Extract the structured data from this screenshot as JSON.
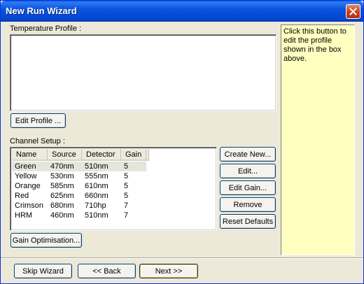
{
  "window": {
    "title": "New Run Wizard"
  },
  "temperature_profile": {
    "label": "Temperature Profile :",
    "edit_button": "Edit Profile ..."
  },
  "help": {
    "text": "Click this button to edit the profile shown in the box above."
  },
  "channel_setup": {
    "label": "Channel Setup :",
    "columns": [
      "Name",
      "Source",
      "Detector",
      "Gain"
    ],
    "rows": [
      [
        "Green",
        "470nm",
        "510nm",
        "5"
      ],
      [
        "Yellow",
        "530nm",
        "555nm",
        "5"
      ],
      [
        "Orange",
        "585nm",
        "610nm",
        "5"
      ],
      [
        "Red",
        "625nm",
        "660nm",
        "5"
      ],
      [
        "Crimson",
        "680nm",
        "710hp",
        "7"
      ],
      [
        "HRM",
        "460nm",
        "510nm",
        "7"
      ]
    ],
    "selected_row": 0,
    "buttons": {
      "create_new": "Create New...",
      "edit": "Edit...",
      "edit_gain": "Edit Gain...",
      "remove": "Remove",
      "reset_defaults": "Reset Defaults"
    },
    "gain_optimisation": "Gain Optimisation..."
  },
  "footer": {
    "skip_wizard": "Skip Wizard",
    "back": "<< Back",
    "next": "Next >>"
  }
}
